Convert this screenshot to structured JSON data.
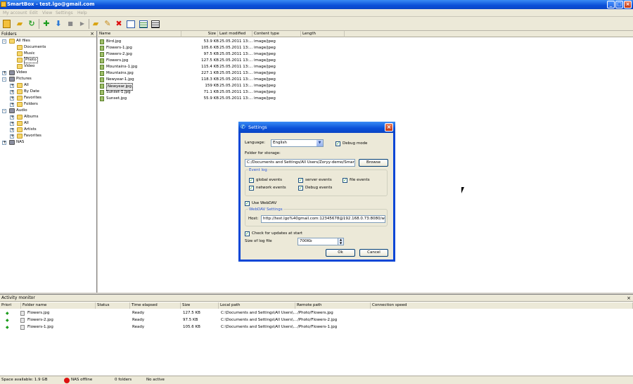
{
  "window": {
    "title": "SmartBox - test.lgo@gmail.com"
  },
  "menu": [
    "My account",
    "Edit",
    "View",
    "Settings",
    "Help"
  ],
  "folders": {
    "header": "Folders",
    "items": [
      {
        "label": "All files",
        "depth": 0,
        "expand": "-"
      },
      {
        "label": "Documents",
        "depth": 1,
        "expand": ""
      },
      {
        "label": "Music",
        "depth": 1,
        "expand": ""
      },
      {
        "label": "Photo",
        "depth": 1,
        "expand": "",
        "selected": true
      },
      {
        "label": "Video",
        "depth": 1,
        "expand": ""
      },
      {
        "label": "Video",
        "depth": 0,
        "expand": "+"
      },
      {
        "label": "Pictures",
        "depth": 0,
        "expand": "-"
      },
      {
        "label": "All",
        "depth": 1,
        "expand": "+"
      },
      {
        "label": "By Date",
        "depth": 1,
        "expand": "+"
      },
      {
        "label": "Favorites",
        "depth": 1,
        "expand": "+"
      },
      {
        "label": "Folders",
        "depth": 1,
        "expand": "+"
      },
      {
        "label": "Audio",
        "depth": 0,
        "expand": "-"
      },
      {
        "label": "Albums",
        "depth": 1,
        "expand": "+"
      },
      {
        "label": "All",
        "depth": 1,
        "expand": "+"
      },
      {
        "label": "Artists",
        "depth": 1,
        "expand": "+"
      },
      {
        "label": "Favorites",
        "depth": 1,
        "expand": "+"
      },
      {
        "label": "NAS",
        "depth": 0,
        "expand": "+"
      }
    ]
  },
  "files": {
    "columns": [
      "Name",
      "Size",
      "Last modified",
      "Content type",
      "Length"
    ],
    "rows": [
      {
        "name": "Bird.jpg",
        "size": "53.9 KB",
        "modified": "25.05.2011 13:...",
        "type": "image/jpeg"
      },
      {
        "name": "Flowers-1.jpg",
        "size": "105.6 KB",
        "modified": "25.05.2011 13:...",
        "type": "image/jpeg"
      },
      {
        "name": "Flowers-2.jpg",
        "size": "97.5 KB",
        "modified": "25.05.2011 13:...",
        "type": "image/jpeg"
      },
      {
        "name": "Flowers.jpg",
        "size": "127.5 KB",
        "modified": "25.05.2011 13:...",
        "type": "image/jpeg"
      },
      {
        "name": "Mountains-1.jpg",
        "size": "115.4 KB",
        "modified": "25.05.2011 13:...",
        "type": "image/jpeg"
      },
      {
        "name": "Mountains.jpg",
        "size": "227.1 KB",
        "modified": "25.05.2011 13:...",
        "type": "image/jpeg"
      },
      {
        "name": "Newyear-1.jpg",
        "size": "118.3 KB",
        "modified": "25.05.2011 13:...",
        "type": "image/jpeg"
      },
      {
        "name": "Newyear.jpg",
        "size": "159 KB",
        "modified": "25.05.2011 13:...",
        "type": "image/jpeg",
        "selected": true
      },
      {
        "name": "Sunset-1.jpg",
        "size": "71.1 KB",
        "modified": "25.05.2011 13:...",
        "type": "image/jpeg"
      },
      {
        "name": "Sunset.jpg",
        "size": "55.9 KB",
        "modified": "25.05.2011 13:...",
        "type": "image/jpeg"
      }
    ]
  },
  "activity": {
    "title": "Activity monitor",
    "columns": [
      "Priori",
      "Folder name",
      "Status",
      "Time elapsed",
      "Size",
      "Local path",
      "Remote path",
      "Connection speed"
    ],
    "rows": [
      {
        "name": "Flowers.jpg",
        "status": "Ready",
        "size": "127.5 KB",
        "local": "C:\\Documents and Settings\\All Users\\...",
        "remote": "/Photo/Flowers.jpg"
      },
      {
        "name": "Flowers-2.jpg",
        "status": "Ready",
        "size": "97.5 KB",
        "local": "C:\\Documents and Settings\\All Users\\...",
        "remote": "/Photo/Flowers-2.jpg"
      },
      {
        "name": "Flowers-1.jpg",
        "status": "Ready",
        "size": "105.6 KB",
        "local": "C:\\Documents and Settings\\All Users\\...",
        "remote": "/Photo/Flowers-1.jpg"
      }
    ]
  },
  "status": {
    "space": "Space available: 1.9 GB",
    "nas": "NAS offline",
    "folders": "0 folders",
    "mode": "No active"
  },
  "dialog": {
    "title": "Settings",
    "language_label": "Language:",
    "language_value": "English",
    "debug_mode": "Debug mode",
    "folder_label": "Folder for storage:",
    "folder_value": "C:/Documents and Settings/All Users/Zoryy-demo/SmartBox",
    "browse": "Browse",
    "event_log": "Event log",
    "events": [
      "global events",
      "server events",
      "file events",
      "network events",
      "Debug events"
    ],
    "use_webdav": "Use WebDAV",
    "webdav_settings": "WebDAV Settings",
    "host_label": "Host:",
    "host_value": "http://test.lgo%40gmail.com:12345678@192.168.0.73:8080/webdav",
    "check_updates": "Check for updates at start",
    "size_label": "Size of log file",
    "size_value": "700Kb",
    "ok": "Ok",
    "cancel": "Cancel"
  }
}
